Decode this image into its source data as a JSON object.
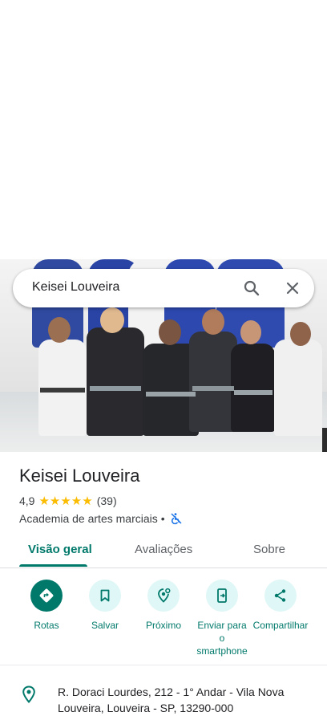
{
  "search": {
    "query": "Keisei Louveira"
  },
  "place": {
    "name": "Keisei Louveira",
    "rating": "4,9",
    "stars": "★★★★★",
    "reviews": "(39)",
    "category": "Academia de artes marciais",
    "separator": "•"
  },
  "tabs": [
    {
      "label": "Visão geral",
      "active": true
    },
    {
      "label": "Avaliações",
      "active": false
    },
    {
      "label": "Sobre",
      "active": false
    }
  ],
  "actions": [
    {
      "label": "Rotas",
      "icon": "directions-icon"
    },
    {
      "label": "Salvar",
      "icon": "bookmark-icon"
    },
    {
      "label": "Próximo",
      "icon": "nearby-icon"
    },
    {
      "label": "Enviar para o smartphone",
      "icon": "send-to-phone-icon"
    },
    {
      "label": "Compartilhar",
      "icon": "share-icon"
    }
  ],
  "address": {
    "text": "R. Doraci Lourdes, 212 - 1° Andar - Vila Nova Louveira, Louveira - SP, 13290-000"
  },
  "colors": {
    "accent": "#00796b",
    "accent_light": "#dff7f6",
    "star": "#fbbc04"
  }
}
